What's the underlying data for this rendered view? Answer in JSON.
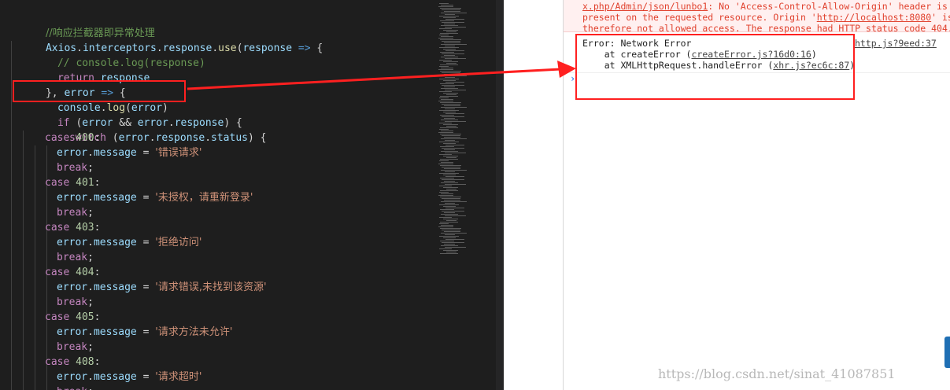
{
  "editor": {
    "lines": {
      "l1": {
        "comment": "//响应拦截器即异常处理"
      },
      "l2": {
        "cls": "Axios",
        "a": ".",
        "b": "interceptors",
        "c": ".",
        "d": "response",
        "e": ".",
        "fn": "use",
        "f": "(",
        "param": "response",
        "arrow": " =>",
        "g": " {"
      },
      "l3": {
        "comment": "// console.log(response)"
      },
      "l4": {
        "kw": "return",
        "var": " response"
      },
      "l5": {
        "a": "}, ",
        "param": "error",
        "arrow": " =>",
        "b": " {"
      },
      "l6": {
        "var": "console",
        "a": ".",
        "fn": "log",
        "b": "(",
        "param": "error",
        "c": ")"
      },
      "l7": {
        "kw": "if",
        "a": " (",
        "v1": "error",
        "b": " && ",
        "v2": "error",
        "c": ".",
        "v3": "response",
        "d": ") {"
      },
      "l8": {
        "kw": "switch",
        "a": " (",
        "v1": "error",
        "b": ".",
        "v2": "response",
        "c": ".",
        "v3": "status",
        "d": ") {"
      }
    },
    "cases": [
      {
        "kw": "case",
        "num": "400",
        "colon": ":",
        "var": "error",
        "dot": ".",
        "prop": "message",
        "eq": " = ",
        "str": "'错误请求'",
        "brk": "break",
        "semi": ";"
      },
      {
        "kw": "case",
        "num": "401",
        "colon": ":",
        "var": "error",
        "dot": ".",
        "prop": "message",
        "eq": " = ",
        "str": "'未授权，请重新登录'",
        "brk": "break",
        "semi": ";"
      },
      {
        "kw": "case",
        "num": "403",
        "colon": ":",
        "var": "error",
        "dot": ".",
        "prop": "message",
        "eq": " = ",
        "str": "'拒绝访问'",
        "brk": "break",
        "semi": ";"
      },
      {
        "kw": "case",
        "num": "404",
        "colon": ":",
        "var": "error",
        "dot": ".",
        "prop": "message",
        "eq": " = ",
        "str": "'请求错误,未找到该资源'",
        "brk": "break",
        "semi": ";"
      },
      {
        "kw": "case",
        "num": "405",
        "colon": ":",
        "var": "error",
        "dot": ".",
        "prop": "message",
        "eq": " = ",
        "str": "'请求方法未允许'",
        "brk": "break",
        "semi": ";"
      },
      {
        "kw": "case",
        "num": "408",
        "colon": ":",
        "var": "error",
        "dot": ".",
        "prop": "message",
        "eq": " = ",
        "str": "'请求超时'",
        "brk": "break",
        "semi": ";"
      }
    ]
  },
  "console": {
    "cors": {
      "path": "x.php/Admin/json/lunbo1",
      "rest1": ": No 'Access-Control-Allow-Origin' header is",
      "line2a": "present on the requested resource. Origin '",
      "origin": "http://localhost:8080",
      "line2b": "' is",
      "line3": "therefore not allowed access. The response had HTTP status code 404."
    },
    "error": {
      "title": "Error: Network Error",
      "at1": "    at createError (",
      "src1": "createError.js?16d0:16",
      "close1": ")",
      "at2": "    at XMLHttpRequest.handleError (",
      "src2": "xhr.js?ec6c:87",
      "close2": ")",
      "source": "http.js?9eed:37"
    },
    "prompt_icon": "chevron-right-icon",
    "prompt": "›"
  },
  "annotation_color": "#ff2020",
  "watermark": "https://blog.csdn.net/sinat_41087851"
}
